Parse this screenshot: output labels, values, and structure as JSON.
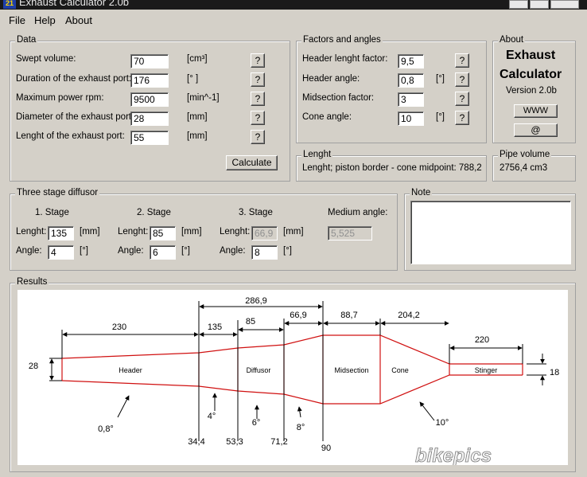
{
  "window": {
    "title": "Exhaust Calculator 2.0b",
    "icon_text": "21"
  },
  "menu": [
    "File",
    "Help",
    "About"
  ],
  "data_group": {
    "title": "Data",
    "rows": [
      {
        "label": "Swept volume:",
        "value": "70",
        "unit": "[cm³]"
      },
      {
        "label": "Duration of the exhaust port:",
        "value": "176",
        "unit": "[° ]"
      },
      {
        "label": "Maximum power rpm:",
        "value": "9500",
        "unit": "[min^-1]"
      },
      {
        "label": "Diameter of the exhaust port:",
        "value": "28",
        "unit": "[mm]"
      },
      {
        "label": "Lenght of the exhaust port:",
        "value": "55",
        "unit": "[mm]"
      }
    ],
    "help_label": "?",
    "calculate_label": "Calculate"
  },
  "factors_group": {
    "title": "Factors and angles",
    "rows": [
      {
        "label": "Header lenght factor:",
        "value": "9,5",
        "unit": ""
      },
      {
        "label": "Header angle:",
        "value": "0,8",
        "unit": "[°]"
      },
      {
        "label": "Midsection factor:",
        "value": "3",
        "unit": ""
      },
      {
        "label": "Cone angle:",
        "value": "10",
        "unit": "[°]"
      }
    ]
  },
  "about_group": {
    "title": "About",
    "line1": "Exhaust",
    "line2": "Calculator",
    "version": "Version 2.0b",
    "www_label": "WWW",
    "mail_label": "@"
  },
  "lenght_group": {
    "title": "Lenght",
    "text": "Lenght; piston border - cone midpoint:  788,2"
  },
  "pipe_group": {
    "title": "Pipe volume",
    "text": "2756,4 cm3"
  },
  "diffusor_group": {
    "title": "Three stage diffusor",
    "length_label": "Lenght:",
    "angle_label": "Angle:",
    "unit_mm": "[mm]",
    "unit_deg": "[°]",
    "stages": [
      {
        "title": "1. Stage",
        "length": "135",
        "angle": "4"
      },
      {
        "title": "2. Stage",
        "length": "85",
        "angle": "6"
      },
      {
        "title": "3. Stage",
        "length": "66,9",
        "angle": "8"
      }
    ],
    "medium_title": "Medium angle:",
    "medium_value": "5,525"
  },
  "note_group": {
    "title": "Note",
    "text": ""
  },
  "results_group": {
    "title": "Results",
    "sections": [
      "Header",
      "Diffusor",
      "Midsection",
      "Cone",
      "Stinger"
    ],
    "dims": {
      "header": "230",
      "stage1": "135",
      "stage2": "85",
      "stage3": "66,9",
      "diffusor_total": "286,9",
      "mid": "88,7",
      "cone": "204,2",
      "stinger": "220",
      "inlet_d": "28",
      "stinger_d": "18"
    },
    "diameters": [
      "34,4",
      "53,3",
      "71,2",
      "90"
    ],
    "angles": [
      "0,8°",
      "4°",
      "6°",
      "8°",
      "10°"
    ],
    "watermark": "bikepics"
  }
}
